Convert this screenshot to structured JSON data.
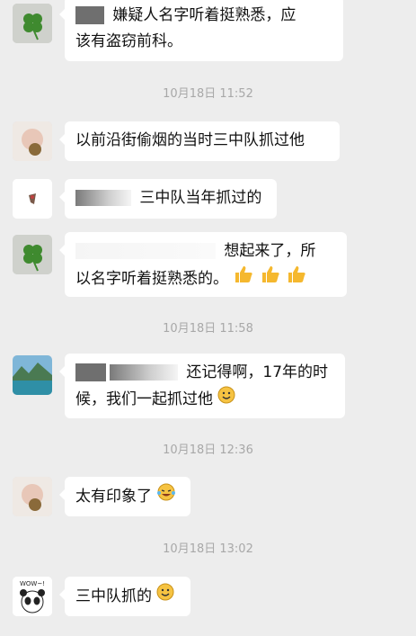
{
  "messages": [
    {
      "lines": [
        "嫌疑人名字听着挺熟悉，应",
        "该有盗窃前科。"
      ]
    },
    {
      "timestamp": "10月18日 11:52"
    },
    {
      "lines": [
        "以前沿街偷烟的当时三中队抓过他"
      ]
    },
    {
      "lines": [
        "三中队当年抓过的"
      ]
    },
    {
      "lines": [
        "想起来了，所",
        "以名字听着挺熟悉的。"
      ]
    },
    {
      "timestamp": "10月18日 11:58"
    },
    {
      "lines": [
        "还记得啊，17年的时",
        "候，我们一起抓过他"
      ]
    },
    {
      "timestamp": "10月18日 12:36"
    },
    {
      "lines": [
        "太有印象了"
      ]
    },
    {
      "timestamp": "10月18日 13:02"
    },
    {
      "lines": [
        "三中队抓的"
      ],
      "avatar_text": "WOW~!"
    }
  ],
  "icons": {
    "clover": "four-leaf-clover-icon",
    "thumbs": "thumbs-up-emoji",
    "smile": "smile-emoji",
    "laugh_cry": "laugh-cry-emoji",
    "panda": "panda-avatar",
    "lake": "lake-landscape-avatar"
  }
}
